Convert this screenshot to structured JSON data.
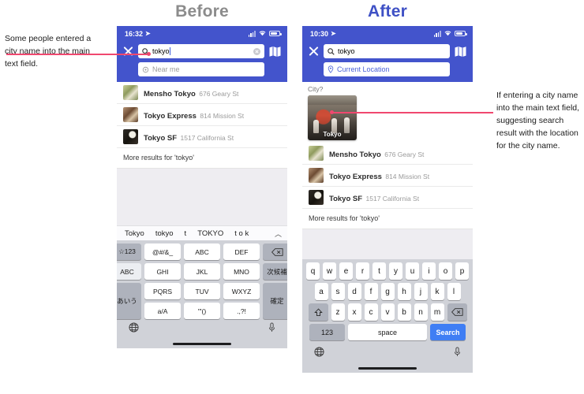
{
  "panels": {
    "before": {
      "title": "Before"
    },
    "after": {
      "title": "After"
    }
  },
  "colors": {
    "header_blue": "#4354cc",
    "after_title_blue": "#3f51c5",
    "before_title_gray": "#8c8c8c",
    "annotation_pink": "#f0486f",
    "keyboard_gray": "#d0d2d8",
    "search_key_blue": "#3f7ef4",
    "link_blue": "#4a62d8",
    "filler_gray": "#eeedf1"
  },
  "before": {
    "status": {
      "time": "16:32",
      "location_icon": "location-arrow-icon",
      "signal_icon": "signal-bars-icon",
      "wifi_icon": "wifi-icon",
      "battery_icon": "battery-icon"
    },
    "close_icon": "close-icon",
    "map_icon": "map-icon",
    "search": {
      "icon": "search-icon",
      "value": "tokyo",
      "clear_icon": "clear-circle-icon"
    },
    "subfield": {
      "icon": "target-icon",
      "placeholder": "Near me"
    },
    "results": [
      {
        "name": "Mensho Tokyo",
        "address": "676 Geary St",
        "thumb": "ramen-thumb"
      },
      {
        "name": "Tokyo Express",
        "address": "814 Mission St",
        "thumb": "meat-thumb"
      },
      {
        "name": "Tokyo SF",
        "address": "1517 California St",
        "thumb": "dark-dish-thumb"
      }
    ],
    "more_results": "More results for 'tokyo'",
    "predictions": [
      "Tokyo",
      "tokyo",
      "t",
      "TOKYO",
      "t o k"
    ],
    "predict_chevron": "chevron-up-icon",
    "keyboard": {
      "type": "japanese-10key",
      "rows": [
        [
          "☆123",
          "@#/&_",
          "ABC",
          "DEF",
          "delete-icon"
        ],
        [
          "ABC",
          "GHI",
          "JKL",
          "MNO",
          "次候補"
        ],
        [
          "あいう",
          "PQRS",
          "TUV",
          "WXYZ",
          "確定"
        ],
        [
          "a/A",
          "'\"()",
          ".,?!"
        ]
      ],
      "globe_icon": "globe-icon",
      "mic_icon": "microphone-icon"
    }
  },
  "after": {
    "status": {
      "time": "10:30",
      "location_icon": "location-arrow-icon",
      "signal_icon": "signal-bars-icon",
      "wifi_icon": "wifi-icon",
      "battery_icon": "battery-icon"
    },
    "close_icon": "close-icon",
    "map_icon": "map-icon",
    "search": {
      "icon": "search-icon",
      "value": "tokyo"
    },
    "subfield": {
      "icon": "location-pin-icon",
      "value": "Current Location"
    },
    "city_section": {
      "label": "City?",
      "card_caption": "Tokyo"
    },
    "results": [
      {
        "name": "Mensho Tokyo",
        "address": "676 Geary St",
        "thumb": "ramen-thumb"
      },
      {
        "name": "Tokyo Express",
        "address": "814 Mission St",
        "thumb": "meat-thumb"
      },
      {
        "name": "Tokyo SF",
        "address": "1517 California St",
        "thumb": "dark-dish-thumb"
      }
    ],
    "more_results": "More results for 'tokyo'",
    "keyboard": {
      "type": "qwerty",
      "row1": [
        "q",
        "w",
        "e",
        "r",
        "t",
        "y",
        "u",
        "i",
        "o",
        "p"
      ],
      "row2": [
        "a",
        "s",
        "d",
        "f",
        "g",
        "h",
        "j",
        "k",
        "l"
      ],
      "row3": [
        "z",
        "x",
        "c",
        "v",
        "b",
        "n",
        "m"
      ],
      "shift_icon": "shift-icon",
      "delete_icon": "delete-icon",
      "numbers_key": "123",
      "space_key": "space",
      "search_key": "Search",
      "globe_icon": "globe-icon",
      "mic_icon": "microphone-icon"
    }
  },
  "annotations": {
    "left": "Some people entered a city name into the main text field.",
    "right": "If entering a city name into the main text field, suggesting search result with the location for the city name."
  }
}
